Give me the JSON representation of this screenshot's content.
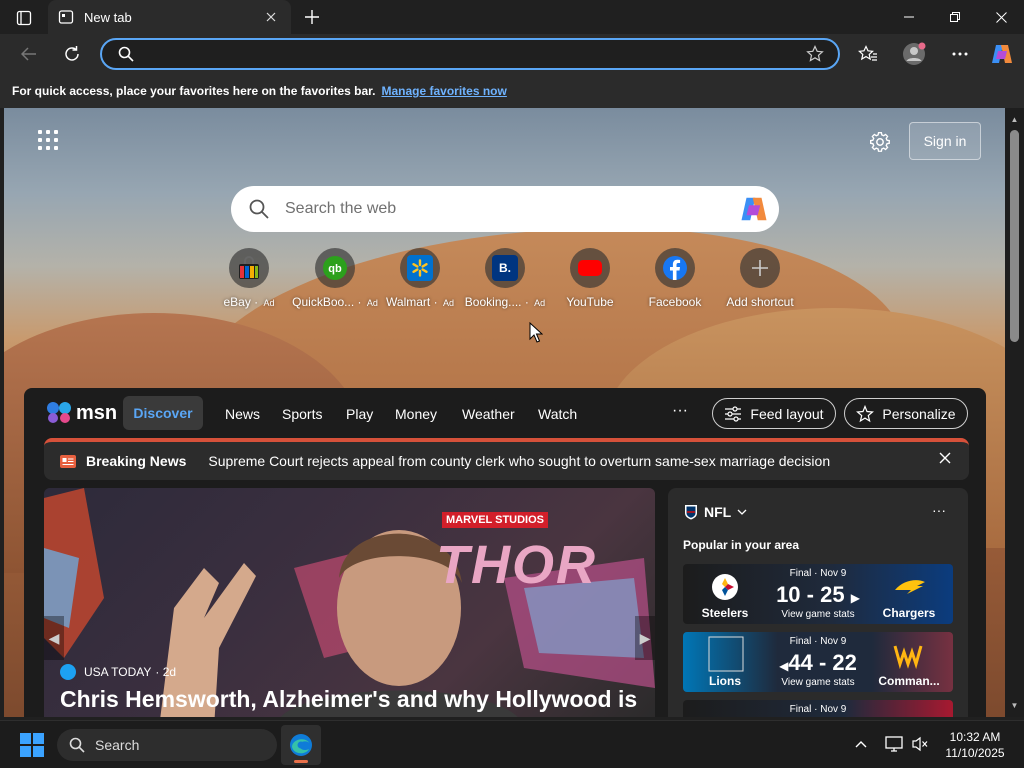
{
  "browser": {
    "tab_title": "New tab",
    "address_value": "",
    "favorites_hint": "For quick access, place your favorites here on the favorites bar.",
    "favorites_link": "Manage favorites now"
  },
  "newtab": {
    "signin_label": "Sign in",
    "search_placeholder": "Search the web",
    "shortcuts": [
      {
        "label": "eBay",
        "ad": "Ad"
      },
      {
        "label": "QuickBoo...",
        "ad": "Ad"
      },
      {
        "label": "Walmart",
        "ad": "Ad"
      },
      {
        "label": "Booking....",
        "ad": "Ad"
      },
      {
        "label": "YouTube",
        "ad": ""
      },
      {
        "label": "Facebook",
        "ad": ""
      },
      {
        "label": "Add shortcut",
        "ad": ""
      }
    ]
  },
  "feed": {
    "logo_text": "msn",
    "nav": {
      "discover": "Discover",
      "news": "News",
      "sports": "Sports",
      "play": "Play",
      "money": "Money",
      "weather": "Weather",
      "watch": "Watch",
      "more": "···"
    },
    "feed_layout_label": "Feed layout",
    "personalize_label": "Personalize",
    "breaking": {
      "title": "Breaking News",
      "text": "Supreme Court rejects appeal from county clerk who sought to overturn same-sex marriage decision"
    },
    "hero": {
      "source": "USA TODAY",
      "age": "· 2d",
      "headline": "Chris Hemsworth, Alzheimer's and why Hollywood is",
      "poster_brand": "MARVEL STUDIOS",
      "poster_title": "THOR"
    },
    "sports": {
      "league": "NFL",
      "more": "···",
      "popular": "Popular in your area",
      "games": [
        {
          "status": "Final · Nov 9",
          "score": "10 - 25",
          "stats": "View game stats",
          "home": "Steelers",
          "away": "Chargers"
        },
        {
          "status": "Final · Nov 9",
          "score": "44 - 22",
          "stats": "View game stats",
          "home": "Lions",
          "away": "Comman..."
        },
        {
          "status": "Final · Nov 9"
        }
      ]
    }
  },
  "taskbar": {
    "search_label": "Search",
    "time": "10:32 AM",
    "date": "11/10/2025"
  },
  "colors": {
    "accent": "#5aa6f5",
    "breaking_red": "#d6513a",
    "taskbar_bg": "#1c1c1c"
  }
}
